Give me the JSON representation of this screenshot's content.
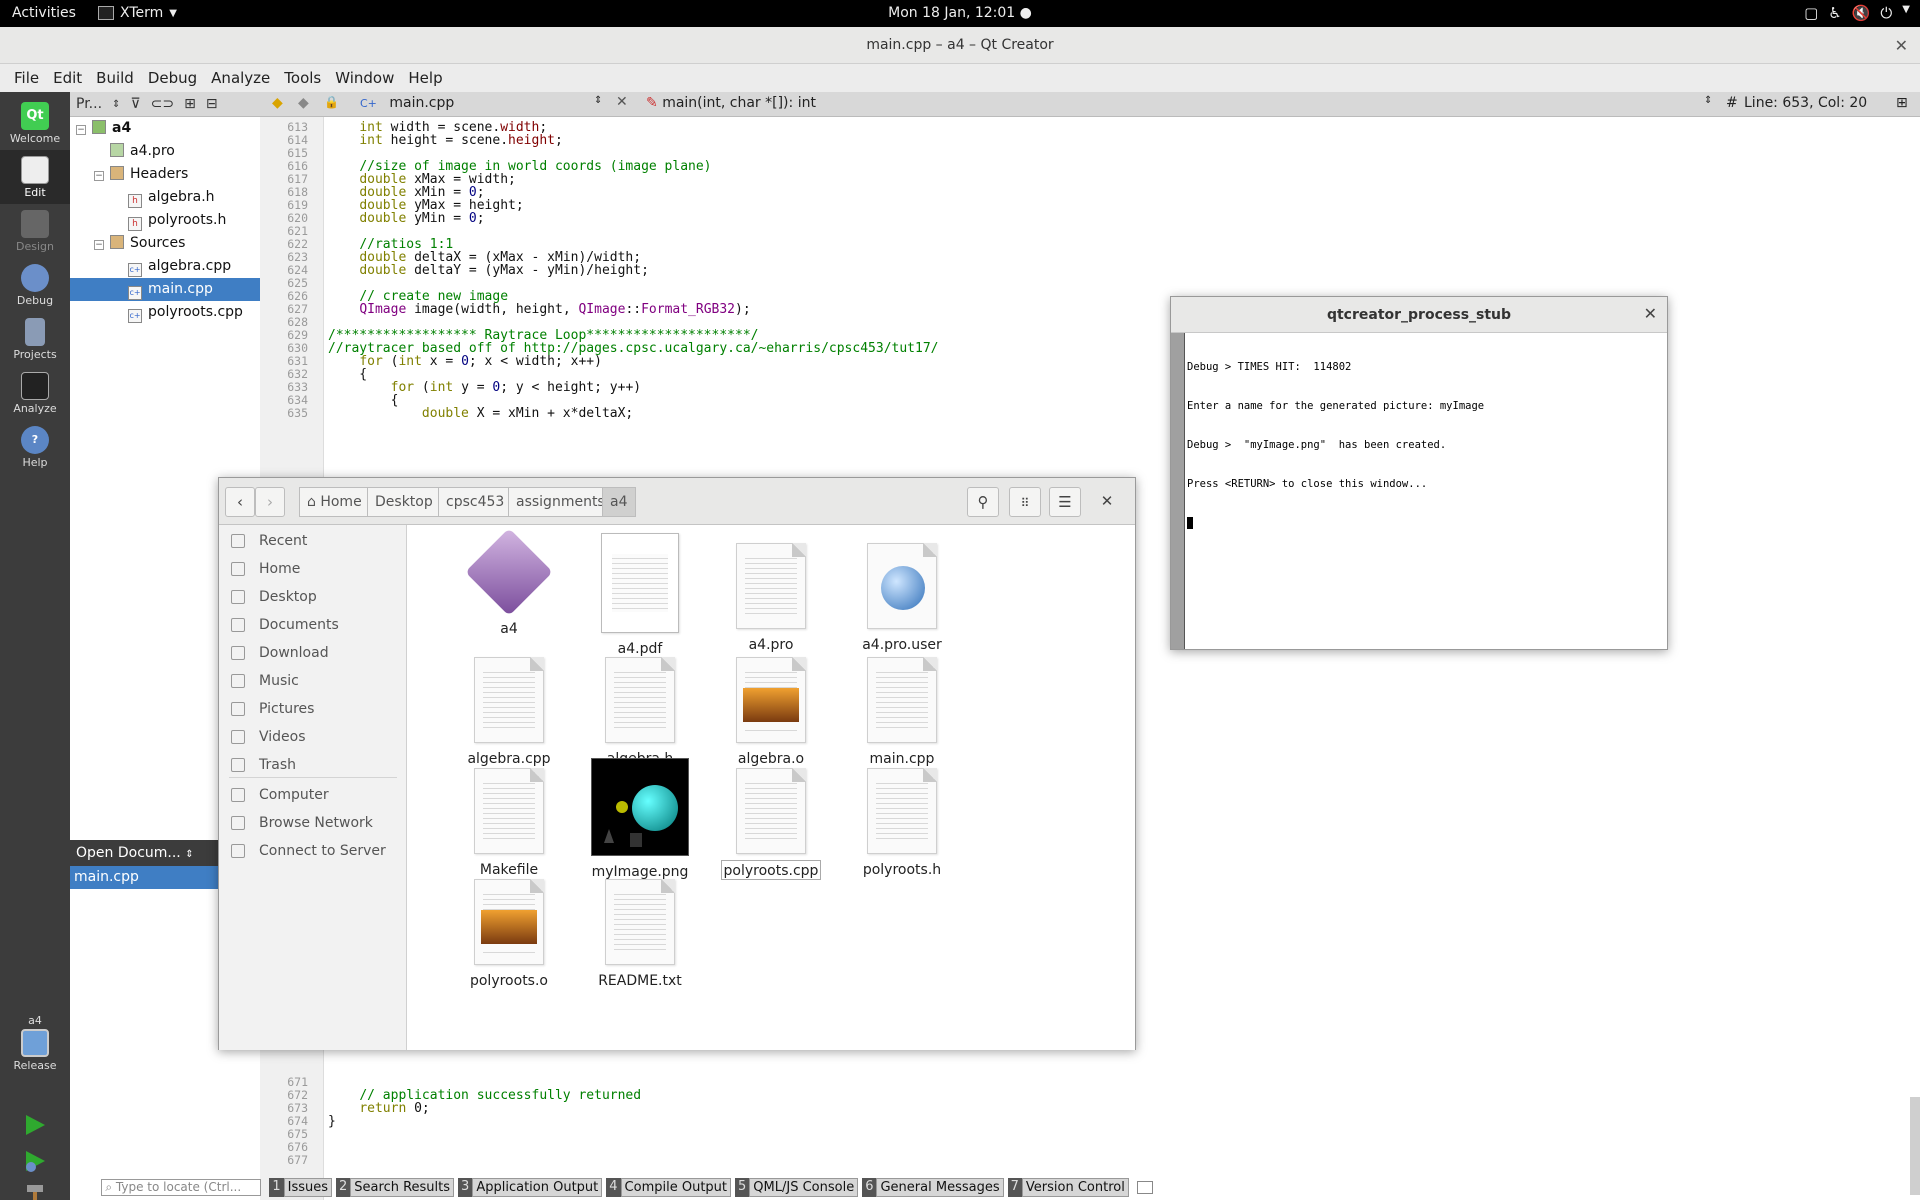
{
  "topbar": {
    "activities": "Activities",
    "app_name": "XTerm",
    "clock": "Mon 18 Jan, 12:01"
  },
  "qt": {
    "title": "main.cpp – a4 – Qt Creator",
    "menu": [
      "File",
      "Edit",
      "Build",
      "Debug",
      "Analyze",
      "Tools",
      "Window",
      "Help"
    ],
    "modes": [
      "Welcome",
      "Edit",
      "Design",
      "Debug",
      "Projects",
      "Analyze",
      "Help"
    ],
    "kit": {
      "project": "a4",
      "config": "Release"
    },
    "project_selector": "Pr...",
    "tree": [
      {
        "label": "a4",
        "level": 0
      },
      {
        "label": "a4.pro",
        "level": 1
      },
      {
        "label": "Headers",
        "level": 1
      },
      {
        "label": "algebra.h",
        "level": 2
      },
      {
        "label": "polyroots.h",
        "level": 2
      },
      {
        "label": "Sources",
        "level": 1
      },
      {
        "label": "algebra.cpp",
        "level": 2
      },
      {
        "label": "main.cpp",
        "level": 2
      },
      {
        "label": "polyroots.cpp",
        "level": 2
      }
    ],
    "open_docs": {
      "header": "Open Docum...",
      "items": [
        "main.cpp"
      ]
    },
    "editor_toolbar": {
      "file": "main.cpp",
      "symbol": "main(int, char *[]): int",
      "position": "Line: 653, Col: 20"
    },
    "locator_placeholder": "Type to locate (Ctrl...",
    "output_tabs": [
      {
        "num": "1",
        "label": "Issues"
      },
      {
        "num": "2",
        "label": "Search Results"
      },
      {
        "num": "3",
        "label": "Application Output"
      },
      {
        "num": "4",
        "label": "Compile Output"
      },
      {
        "num": "5",
        "label": "QML/JS Console"
      },
      {
        "num": "6",
        "label": "General Messages"
      },
      {
        "num": "7",
        "label": "Version Control"
      }
    ]
  },
  "code": {
    "lines_top": [
      {
        "n": "613",
        "t": "    int width = scene.width;"
      },
      {
        "n": "614",
        "t": "    int height = scene.height;"
      },
      {
        "n": "615",
        "t": ""
      },
      {
        "n": "616",
        "t": "    //size of image in world coords (image plane)"
      },
      {
        "n": "617",
        "t": "    double xMax = width;"
      },
      {
        "n": "618",
        "t": "    double xMin = 0;"
      },
      {
        "n": "619",
        "t": "    double yMax = height;"
      },
      {
        "n": "620",
        "t": "    double yMin = 0;"
      },
      {
        "n": "621",
        "t": ""
      },
      {
        "n": "622",
        "t": "    //ratios 1:1"
      },
      {
        "n": "623",
        "t": "    double deltaX = (xMax - xMin)/width;"
      },
      {
        "n": "624",
        "t": "    double deltaY = (yMax - yMin)/height;"
      },
      {
        "n": "625",
        "t": ""
      },
      {
        "n": "626",
        "t": "    // create new image"
      },
      {
        "n": "627",
        "t": "    QImage image(width, height, QImage::Format_RGB32);"
      },
      {
        "n": "628",
        "t": ""
      },
      {
        "n": "629",
        "t": "/****************** Raytrace Loop*********************/"
      },
      {
        "n": "630",
        "t": "//raytracer based off of http://pages.cpsc.ucalgary.ca/~eharris/cpsc453/tut17/"
      },
      {
        "n": "631",
        "t": "    for (int x = 0; x < width; x++)"
      },
      {
        "n": "632",
        "t": "    {"
      },
      {
        "n": "633",
        "t": "        for (int y = 0; y < height; y++)"
      },
      {
        "n": "634",
        "t": "        {"
      },
      {
        "n": "635",
        "t": "            double X = xMin + x*deltaX;"
      }
    ],
    "lines_bottom": [
      {
        "n": "671",
        "t": ""
      },
      {
        "n": "672",
        "t": "    // application successfully returned"
      },
      {
        "n": "673",
        "t": "    return 0;"
      },
      {
        "n": "674",
        "t": "}"
      },
      {
        "n": "675",
        "t": ""
      },
      {
        "n": "676",
        "t": ""
      },
      {
        "n": "677",
        "t": ""
      }
    ]
  },
  "files": {
    "breadcrumbs": [
      "Home",
      "Desktop",
      "cpsc453",
      "assignments",
      "a4"
    ],
    "sidebar": [
      "Recent",
      "Home",
      "Desktop",
      "Documents",
      "Download",
      "Music",
      "Pictures",
      "Videos",
      "Trash",
      "Computer",
      "Browse Network",
      "Connect to Server"
    ],
    "items": [
      {
        "name": "a4",
        "kind": "exec"
      },
      {
        "name": "a4.pdf",
        "kind": "pdf"
      },
      {
        "name": "a4.pro",
        "kind": "text"
      },
      {
        "name": "a4.pro.user",
        "kind": "web"
      },
      {
        "name": "algebra.cpp",
        "kind": "text"
      },
      {
        "name": "algebra.h",
        "kind": "text"
      },
      {
        "name": "algebra.o",
        "kind": "img"
      },
      {
        "name": "main.cpp",
        "kind": "text"
      },
      {
        "name": "Makefile",
        "kind": "text"
      },
      {
        "name": "myImage.png",
        "kind": "render"
      },
      {
        "name": "polyroots.cpp",
        "kind": "text"
      },
      {
        "name": "polyroots.h",
        "kind": "text"
      },
      {
        "name": "polyroots.o",
        "kind": "img"
      },
      {
        "name": "README.txt",
        "kind": "text"
      }
    ]
  },
  "stub": {
    "title": "qtcreator_process_stub",
    "lines": [
      "Debug > TIMES HIT:  114802",
      "Enter a name for the generated picture: myImage",
      "Debug >  \"myImage.png\"  has been created.",
      "Press <RETURN> to close this window..."
    ]
  },
  "colors": {
    "selection": "#3f7ec4",
    "mode_bar": "#3c3c3c",
    "run_green": "#2fa92f"
  }
}
